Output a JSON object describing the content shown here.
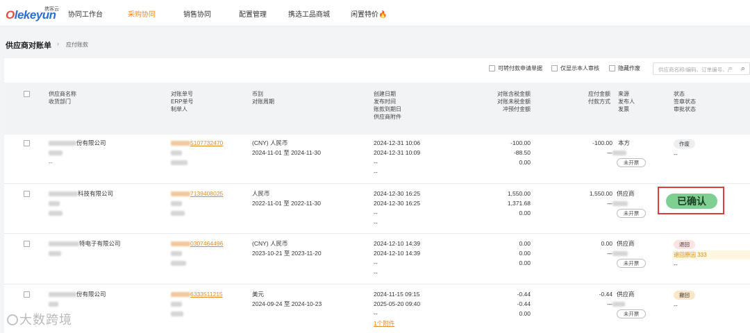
{
  "logo": {
    "brand": "lekeyun",
    "brand_prefix": "O",
    "cn": "携客云"
  },
  "nav": [
    {
      "label": "协同工作台",
      "active": false
    },
    {
      "label": "采购协同",
      "active": true
    },
    {
      "label": "销售协同",
      "active": false
    },
    {
      "label": "配置管理",
      "active": false
    },
    {
      "label": "携选工品商城",
      "active": false
    },
    {
      "label": "闲置特价",
      "active": false
    }
  ],
  "breadcrumb": {
    "title": "供应商对账单",
    "sub": "应付账款"
  },
  "filters": {
    "f1": "可转付款申请单据",
    "f2": "仅显示本人审核",
    "f3": "隐藏作废",
    "search_placeholder": "供应商名称/编码、订单编号、产"
  },
  "headers": {
    "col1": [
      "供应商名称",
      "收货部门"
    ],
    "col2": [
      "对账单号",
      "ERP单号",
      "制单人"
    ],
    "col3": [
      "币别",
      "对账周期"
    ],
    "col4": [
      "创建日期",
      "发布时间",
      "账款到期日",
      "供应商附件"
    ],
    "col5": [
      "对账含税金额",
      "对账未税金额",
      "冲预付金额"
    ],
    "col6": [
      "应付金额",
      "付款方式"
    ],
    "col7": [
      "来源",
      "发布人",
      "发票"
    ],
    "col8": [
      "状态",
      "签章状态",
      "审批状态"
    ]
  },
  "rows": [
    {
      "supplier": "份有限公司",
      "dept": "--",
      "doc_no": "5107732470",
      "currency": "(CNY) 人民币",
      "period": "2024-11-01 至 2024-11-30",
      "created": "2024-12-31 10:06",
      "published": "2024-12-31 10:09",
      "due": "--",
      "attach": "--",
      "tax_amt": "-100.00",
      "untax_amt": "-88.50",
      "prepay": "0.00",
      "payable": "-100.00",
      "pay_method": "--",
      "source": "本方",
      "publisher": "--",
      "invoice": "未开票",
      "status": "作废",
      "sign": "--",
      "approval": ""
    },
    {
      "supplier": "科技有限公司",
      "dept": "",
      "doc_no": "7139408025",
      "currency": "人民币",
      "period": "2022-11-01 至 2022-11-30",
      "created": "2024-12-30 16:25",
      "published": "2024-12-30 16:25",
      "due": "--",
      "attach": "--",
      "tax_amt": "1,550.00",
      "untax_amt": "1,371.68",
      "prepay": "0.00",
      "payable": "1,550.00",
      "pay_method": "--",
      "source": "供应商",
      "publisher": "--",
      "invoice": "未开票",
      "status": "已确认",
      "sign": "",
      "approval": ""
    },
    {
      "supplier": "特电子有限公司",
      "dept": "",
      "doc_no": "0307464496",
      "currency": "(CNY) 人民币",
      "period": "2023-10-21 至 2023-11-20",
      "created": "2024-12-10 14:39",
      "published": "2024-12-10 14:39",
      "due": "--",
      "attach": "--",
      "tax_amt": "0.00",
      "untax_amt": "0.00",
      "prepay": "0.00",
      "payable": "0.00",
      "pay_method": "--",
      "source": "供应商",
      "publisher": "--",
      "invoice": "未开票",
      "status": "退回",
      "sign": "退回原因 333",
      "approval": "--"
    },
    {
      "supplier": "份有限公司",
      "dept": "",
      "doc_no": "6333511215",
      "currency": "美元",
      "period": "2024-09-24 至 2024-10-23",
      "created": "2024-11-15 09:15",
      "published": "2025-05-20 09:40",
      "due": "--",
      "attach": "1个附件",
      "tax_amt": "-0.44",
      "untax_amt": "-0.44",
      "prepay": "0.00",
      "payable": "-0.44",
      "pay_method": "--",
      "source": "供应商",
      "publisher": "--",
      "invoice": "未开票",
      "status": "撤回",
      "sign": "--",
      "approval": ""
    }
  ],
  "watermark": "大数跨境",
  "colors": {
    "accent": "#ef8a17",
    "confirm": "#7fcf92",
    "highlight": "#e0393e"
  }
}
